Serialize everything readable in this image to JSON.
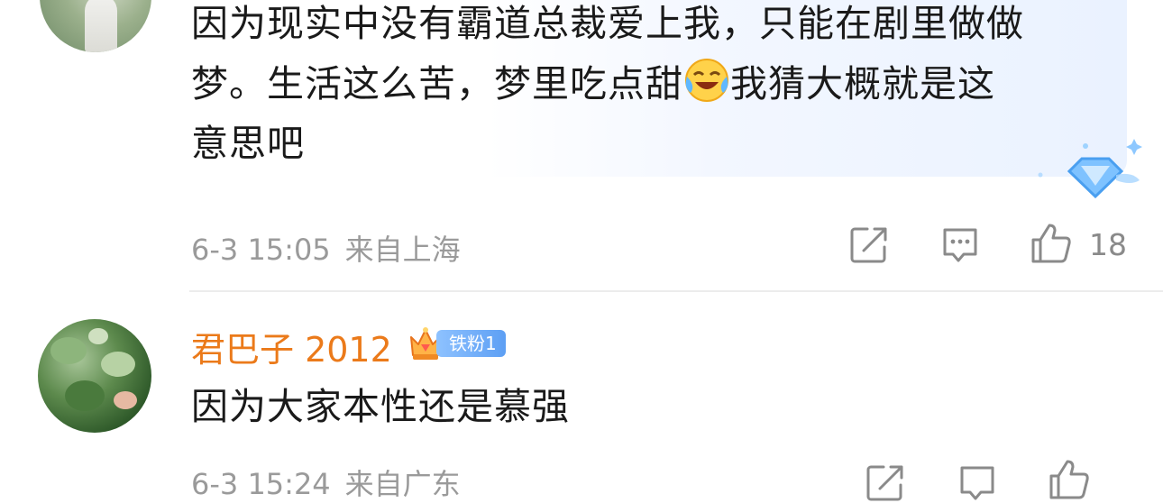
{
  "comments": [
    {
      "text_line1": "因为现实中没有霸道总裁爱上我，只能在剧里做做",
      "text_line2a": "梦。生活这么苦，梦里吃点甜",
      "text_line2b": "我猜大概就是这",
      "text_line3": "意思吧",
      "emoji": "laugh-cry-emoji",
      "time": "6-3 15:05",
      "location": "来自上海",
      "like_count": "18"
    },
    {
      "username": "君巴子 2012",
      "badge": "铁粉1",
      "text": "因为大家本性还是慕强",
      "time": "6-3 15:24",
      "location": "来自广东"
    }
  ],
  "icons": {
    "share": "share-icon",
    "reply": "comment-icon",
    "like": "thumbs-up-icon",
    "crown": "crown-icon",
    "vip": "diamond-icon"
  },
  "colors": {
    "username": "#eb7a1a",
    "meta": "#9a9a9a",
    "badge": "#5d9ff4",
    "bubble": "#eaf2ff"
  }
}
